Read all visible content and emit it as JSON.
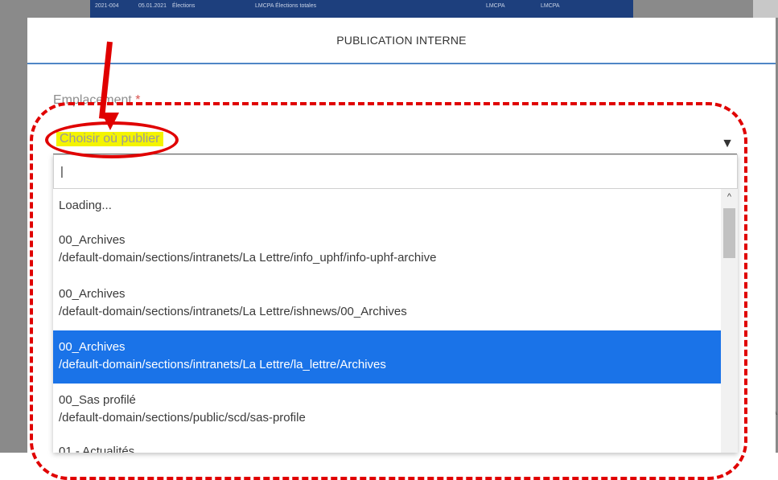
{
  "background": {
    "strip_cells": [
      "2021-004",
      "05.01.2021",
      "Élections",
      "LMCPA Élections totales",
      "LMCPA",
      "LMCPA"
    ]
  },
  "modal": {
    "title": "PUBLICATION INTERNE",
    "field_label": "Emplacement",
    "required_mark": "*",
    "select_placeholder": "Choisir où publier",
    "arrow_glyph": "▼"
  },
  "dropdown": {
    "search_value": "|",
    "scroll_up_glyph": "^",
    "loading_text": "Loading...",
    "options": [
      {
        "name": "00_Archives",
        "path": "/default-domain/sections/intranets/La Lettre/info_uphf/info-uphf-archive",
        "selected": false
      },
      {
        "name": "00_Archives",
        "path": "/default-domain/sections/intranets/La Lettre/ishnews/00_Archives",
        "selected": false
      },
      {
        "name": "00_Archives",
        "path": "/default-domain/sections/intranets/La Lettre/la_lettre/Archives",
        "selected": true
      },
      {
        "name": "00_Sas profilé",
        "path": "/default-domain/sections/public/scd/sas-profile",
        "selected": false
      },
      {
        "name": "01 - Actualités",
        "path": "",
        "selected": false
      }
    ]
  },
  "colors": {
    "selected_bg": "#1a73e8",
    "highlight": "#f4f400",
    "annotation": "#e00000",
    "header_rule": "#4f86c6"
  }
}
